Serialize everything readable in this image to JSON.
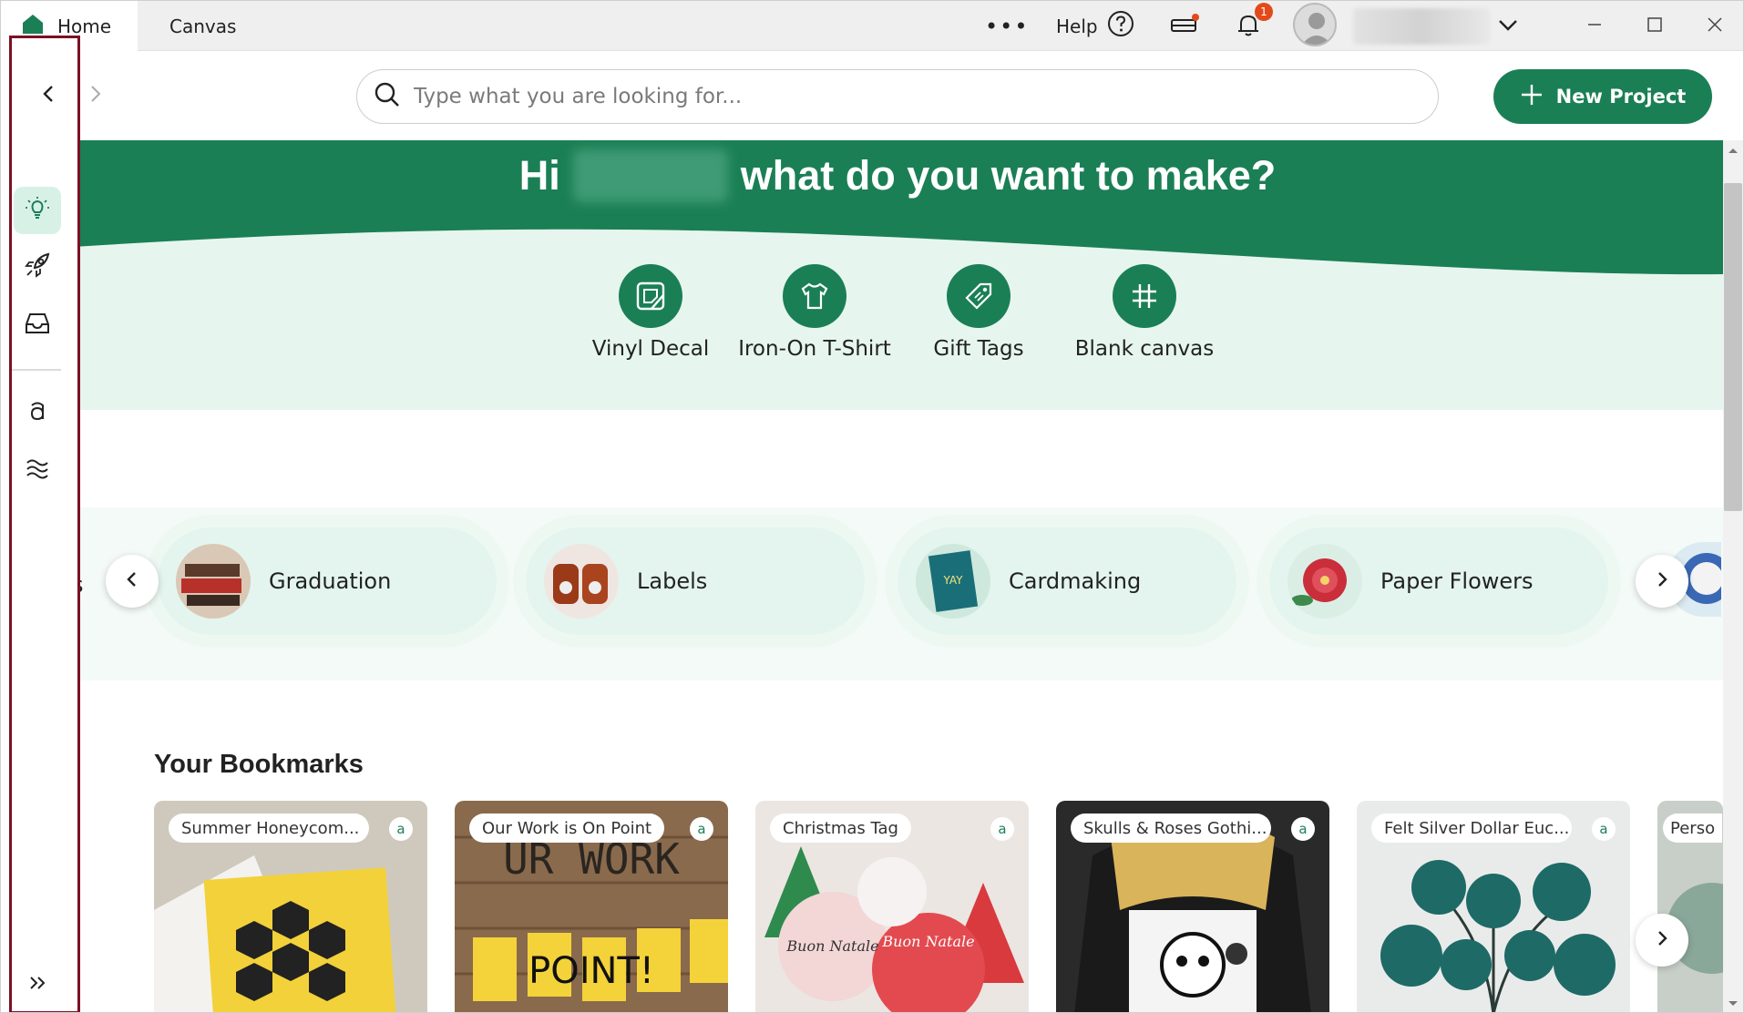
{
  "titlebar": {
    "tabs": [
      {
        "label": "Home"
      },
      {
        "label": "Canvas"
      }
    ],
    "more_label": "•••",
    "help_label": "Help",
    "notification_count": "1"
  },
  "search": {
    "placeholder": "Type what you are looking for..."
  },
  "new_project": {
    "label": "New Project"
  },
  "hero": {
    "greeting": "Hi",
    "question": "what do you want to make?",
    "quick_actions": [
      {
        "label": "Vinyl Decal",
        "icon": "vinyl-decal-icon"
      },
      {
        "label": "Iron-On T-Shirt",
        "icon": "tshirt-icon"
      },
      {
        "label": "Gift Tags",
        "icon": "tag-icon"
      },
      {
        "label": "Blank canvas",
        "icon": "crop-grid-icon"
      }
    ]
  },
  "categories": {
    "partial_left": "s",
    "items": [
      {
        "label": "Graduation"
      },
      {
        "label": "Labels"
      },
      {
        "label": "Cardmaking"
      },
      {
        "label": "Paper Flowers"
      }
    ]
  },
  "bookmarks": {
    "title": "Your Bookmarks",
    "items": [
      {
        "label": "Summer Honeycom..."
      },
      {
        "label": "Our Work is On Point"
      },
      {
        "label": "Christmas Tag"
      },
      {
        "label": "Skulls & Roses Gothi..."
      },
      {
        "label": "Felt Silver Dollar Euc..."
      },
      {
        "label": "Perso"
      }
    ],
    "badge_glyph": "a"
  },
  "colors": {
    "brand_green": "#1b7f55",
    "mint": "#e6f6ef",
    "sidebar_outline": "#7b1024",
    "notification": "#e24a1a"
  }
}
